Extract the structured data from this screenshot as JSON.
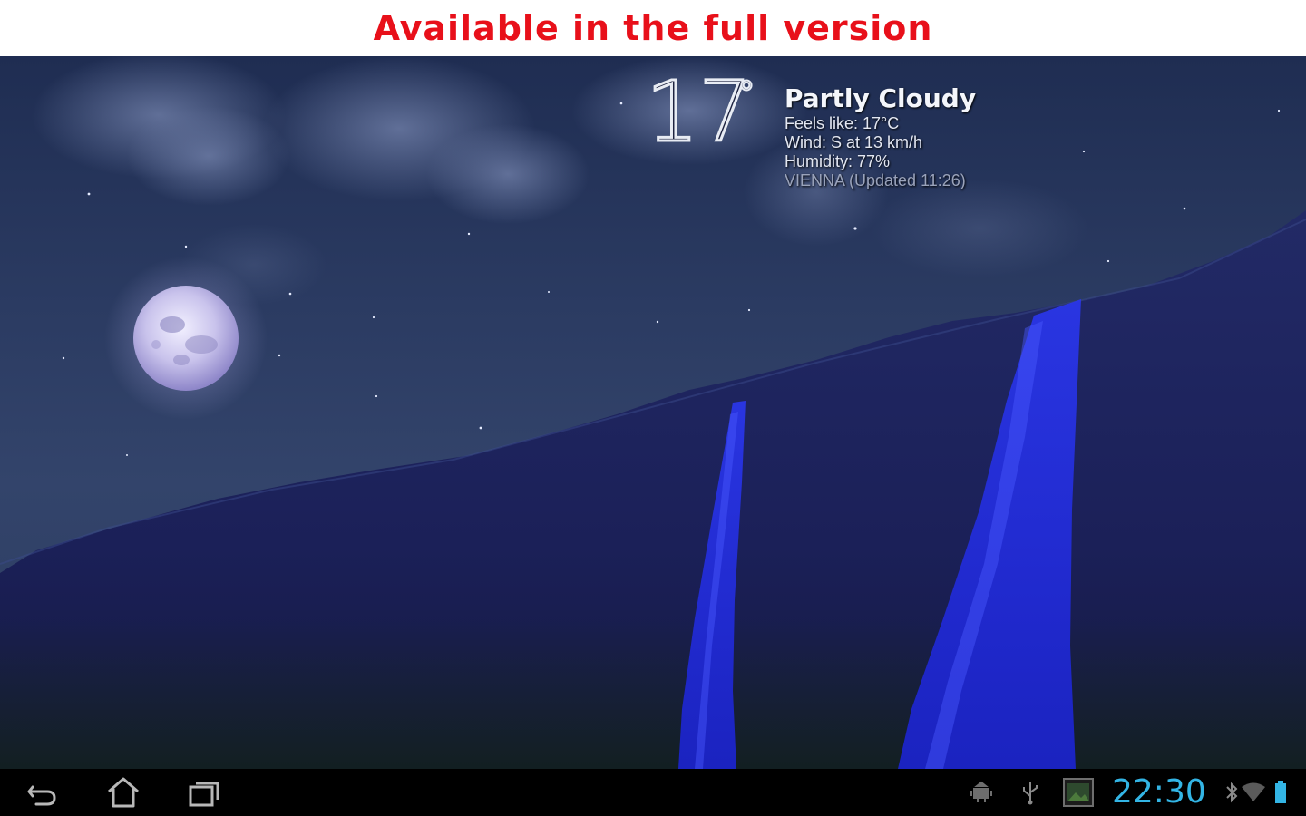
{
  "banner": {
    "text": "Available in the full version",
    "color": "#e8101a"
  },
  "weather": {
    "temperature": "17",
    "degree_symbol": "°",
    "condition": "Partly Cloudy",
    "feels_like": "Feels like: 17°C",
    "wind": "Wind: S at 13 km/h",
    "humidity": "Humidity: 77%",
    "location_updated": "VIENNA (Updated 11:26)"
  },
  "navbar": {
    "back_icon": "back-icon",
    "home_icon": "home-icon",
    "recents_icon": "recent-apps-icon",
    "clock": "22:30",
    "clock_color": "#33b5e5"
  },
  "colors": {
    "waterfall": "#1f2bd8",
    "sky": "#2b3b62",
    "cliff": "#1a1f55"
  }
}
